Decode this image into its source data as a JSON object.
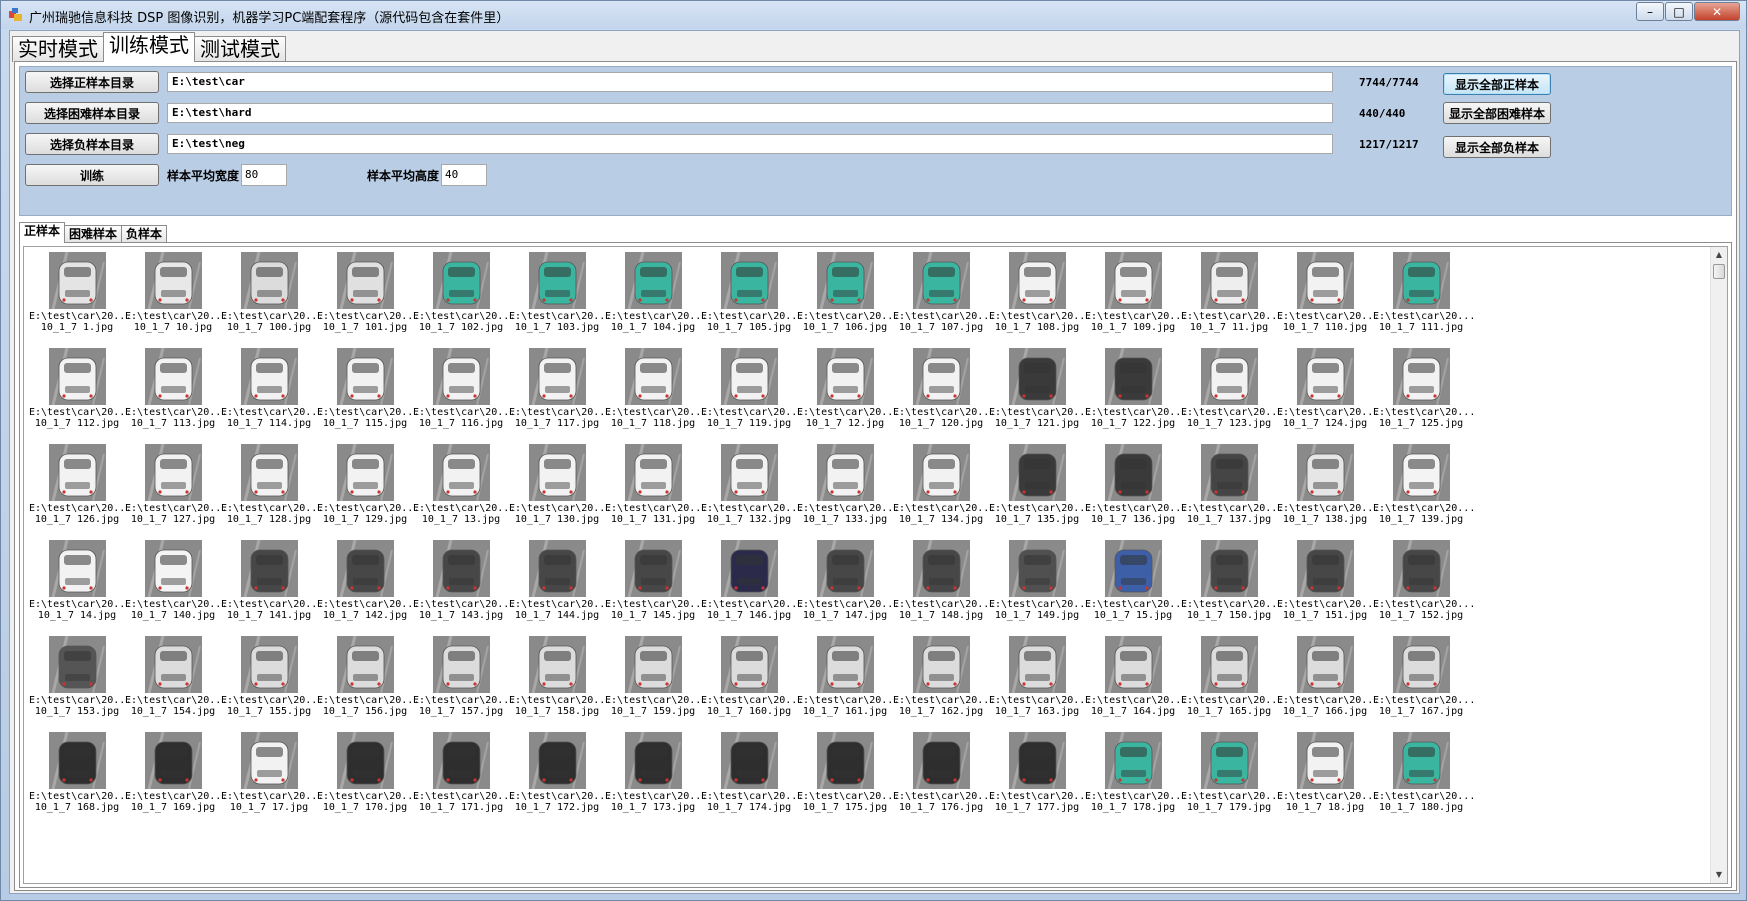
{
  "window": {
    "title": "广州瑞驰信息科技  DSP 图像识别，机器学习PC端配套程序（源代码包含在套件里）",
    "min_label": "–",
    "max_label": "□",
    "close_label": "✕"
  },
  "main_tabs": [
    {
      "label": "实时模式",
      "active": false
    },
    {
      "label": "训练模式",
      "active": true
    },
    {
      "label": "测试模式",
      "active": false
    }
  ],
  "controls": {
    "positive_dir_button": "选择正样本目录",
    "positive_dir_path": "E:\\test\\car",
    "positive_count": "7744/7744",
    "show_all_positive_button": "显示全部正样本",
    "hard_dir_button": "选择困难样本目录",
    "hard_dir_path": "E:\\test\\hard",
    "hard_count": "440/440",
    "show_all_hard_button": "显示全部困难样本",
    "negative_dir_button": "选择负样本目录",
    "negative_dir_path": "E:\\test\\neg",
    "negative_count": "1217/1217",
    "show_all_negative_button": "显示全部负样本",
    "train_button": "训练",
    "avg_width_label": "样本平均宽度",
    "avg_width_value": "80",
    "avg_height_label": "样本平均高度",
    "avg_height_value": "40"
  },
  "sample_tabs": [
    {
      "label": "正样本",
      "active": true
    },
    {
      "label": "困难样本",
      "active": false
    },
    {
      "label": "负样本",
      "active": false
    }
  ],
  "samples": [
    {
      "line1": "E:\\test\\car\\20...",
      "line2": "10_1_7  1.jpg",
      "color": "#e4e4e4"
    },
    {
      "line1": "E:\\test\\car\\20...",
      "line2": "10_1_7  10.jpg",
      "color": "#e8e8e8"
    },
    {
      "line1": "E:\\test\\car\\20...",
      "line2": "10_1_7  100.jpg",
      "color": "#dcdcdc"
    },
    {
      "line1": "E:\\test\\car\\20...",
      "line2": "10_1_7  101.jpg",
      "color": "#e0e0e0"
    },
    {
      "line1": "E:\\test\\car\\20...",
      "line2": "10_1_7  102.jpg",
      "color": "#3ab5a0"
    },
    {
      "line1": "E:\\test\\car\\20...",
      "line2": "10_1_7  103.jpg",
      "color": "#3ab5a0"
    },
    {
      "line1": "E:\\test\\car\\20...",
      "line2": "10_1_7  104.jpg",
      "color": "#3ab5a0"
    },
    {
      "line1": "E:\\test\\car\\20...",
      "line2": "10_1_7  105.jpg",
      "color": "#3ab5a0"
    },
    {
      "line1": "E:\\test\\car\\20...",
      "line2": "10_1_7  106.jpg",
      "color": "#3ab5a0"
    },
    {
      "line1": "E:\\test\\car\\20...",
      "line2": "10_1_7  107.jpg",
      "color": "#3ab5a0"
    },
    {
      "line1": "E:\\test\\car\\20...",
      "line2": "10_1_7  108.jpg",
      "color": "#f2f2f2"
    },
    {
      "line1": "E:\\test\\car\\20...",
      "line2": "10_1_7  109.jpg",
      "color": "#f2f2f2"
    },
    {
      "line1": "E:\\test\\car\\20...",
      "line2": "10_1_7  11.jpg",
      "color": "#eeeeee"
    },
    {
      "line1": "E:\\test\\car\\20...",
      "line2": "10_1_7  110.jpg",
      "color": "#f2f2f2"
    },
    {
      "line1": "E:\\test\\car\\20...",
      "line2": "10_1_7  111.jpg",
      "color": "#3ab5a0"
    },
    {
      "line1": "E:\\test\\car\\20...",
      "line2": "10_1_7  112.jpg",
      "color": "#f2f2f2"
    },
    {
      "line1": "E:\\test\\car\\20...",
      "line2": "10_1_7  113.jpg",
      "color": "#f2f2f2"
    },
    {
      "line1": "E:\\test\\car\\20...",
      "line2": "10_1_7  114.jpg",
      "color": "#f2f2f2"
    },
    {
      "line1": "E:\\test\\car\\20...",
      "line2": "10_1_7  115.jpg",
      "color": "#f2f2f2"
    },
    {
      "line1": "E:\\test\\car\\20...",
      "line2": "10_1_7  116.jpg",
      "color": "#f2f2f2"
    },
    {
      "line1": "E:\\test\\car\\20...",
      "line2": "10_1_7  117.jpg",
      "color": "#f2f2f2"
    },
    {
      "line1": "E:\\test\\car\\20...",
      "line2": "10_1_7  118.jpg",
      "color": "#f2f2f2"
    },
    {
      "line1": "E:\\test\\car\\20...",
      "line2": "10_1_7  119.jpg",
      "color": "#f2f2f2"
    },
    {
      "line1": "E:\\test\\car\\20...",
      "line2": "10_1_7  12.jpg",
      "color": "#f2f2f2"
    },
    {
      "line1": "E:\\test\\car\\20...",
      "line2": "10_1_7  120.jpg",
      "color": "#f2f2f2"
    },
    {
      "line1": "E:\\test\\car\\20...",
      "line2": "10_1_7  121.jpg",
      "color": "#3a3a3a"
    },
    {
      "line1": "E:\\test\\car\\20...",
      "line2": "10_1_7  122.jpg",
      "color": "#3a3a3a"
    },
    {
      "line1": "E:\\test\\car\\20...",
      "line2": "10_1_7  123.jpg",
      "color": "#f2f2f2"
    },
    {
      "line1": "E:\\test\\car\\20...",
      "line2": "10_1_7  124.jpg",
      "color": "#f2f2f2"
    },
    {
      "line1": "E:\\test\\car\\20...",
      "line2": "10_1_7  125.jpg",
      "color": "#f2f2f2"
    },
    {
      "line1": "E:\\test\\car\\20...",
      "line2": "10_1_7  126.jpg",
      "color": "#f2f2f2"
    },
    {
      "line1": "E:\\test\\car\\20...",
      "line2": "10_1_7  127.jpg",
      "color": "#f2f2f2"
    },
    {
      "line1": "E:\\test\\car\\20...",
      "line2": "10_1_7  128.jpg",
      "color": "#f2f2f2"
    },
    {
      "line1": "E:\\test\\car\\20...",
      "line2": "10_1_7  129.jpg",
      "color": "#f2f2f2"
    },
    {
      "line1": "E:\\test\\car\\20...",
      "line2": "10_1_7  13.jpg",
      "color": "#f2f2f2"
    },
    {
      "line1": "E:\\test\\car\\20...",
      "line2": "10_1_7  130.jpg",
      "color": "#f2f2f2"
    },
    {
      "line1": "E:\\test\\car\\20...",
      "line2": "10_1_7  131.jpg",
      "color": "#f2f2f2"
    },
    {
      "line1": "E:\\test\\car\\20...",
      "line2": "10_1_7  132.jpg",
      "color": "#f2f2f2"
    },
    {
      "line1": "E:\\test\\car\\20...",
      "line2": "10_1_7  133.jpg",
      "color": "#f2f2f2"
    },
    {
      "line1": "E:\\test\\car\\20...",
      "line2": "10_1_7  134.jpg",
      "color": "#f2f2f2"
    },
    {
      "line1": "E:\\test\\car\\20...",
      "line2": "10_1_7  135.jpg",
      "color": "#3a3a3a"
    },
    {
      "line1": "E:\\test\\car\\20...",
      "line2": "10_1_7  136.jpg",
      "color": "#3a3a3a"
    },
    {
      "line1": "E:\\test\\car\\20...",
      "line2": "10_1_7  137.jpg",
      "color": "#454545"
    },
    {
      "line1": "E:\\test\\car\\20...",
      "line2": "10_1_7  138.jpg",
      "color": "#e6e6e6"
    },
    {
      "line1": "E:\\test\\car\\20...",
      "line2": "10_1_7  139.jpg",
      "color": "#f4f4f4"
    },
    {
      "line1": "E:\\test\\car\\20...",
      "line2": "10_1_7  14.jpg",
      "color": "#f2f2f2"
    },
    {
      "line1": "E:\\test\\car\\20...",
      "line2": "10_1_7  140.jpg",
      "color": "#f4f4f4"
    },
    {
      "line1": "E:\\test\\car\\20...",
      "line2": "10_1_7  141.jpg",
      "color": "#474747"
    },
    {
      "line1": "E:\\test\\car\\20...",
      "line2": "10_1_7  142.jpg",
      "color": "#474747"
    },
    {
      "line1": "E:\\test\\car\\20...",
      "line2": "10_1_7  143.jpg",
      "color": "#474747"
    },
    {
      "line1": "E:\\test\\car\\20...",
      "line2": "10_1_7  144.jpg",
      "color": "#474747"
    },
    {
      "line1": "E:\\test\\car\\20...",
      "line2": "10_1_7  145.jpg",
      "color": "#474747"
    },
    {
      "line1": "E:\\test\\car\\20...",
      "line2": "10_1_7  146.jpg",
      "color": "#2b2a4a"
    },
    {
      "line1": "E:\\test\\car\\20...",
      "line2": "10_1_7  147.jpg",
      "color": "#474747"
    },
    {
      "line1": "E:\\test\\car\\20...",
      "line2": "10_1_7  148.jpg",
      "color": "#474747"
    },
    {
      "line1": "E:\\test\\car\\20...",
      "line2": "10_1_7  149.jpg",
      "color": "#505050"
    },
    {
      "line1": "E:\\test\\car\\20...",
      "line2": "10_1_7  15.jpg",
      "color": "#3d5fa8"
    },
    {
      "line1": "E:\\test\\car\\20...",
      "line2": "10_1_7  150.jpg",
      "color": "#474747"
    },
    {
      "line1": "E:\\test\\car\\20...",
      "line2": "10_1_7  151.jpg",
      "color": "#474747"
    },
    {
      "line1": "E:\\test\\car\\20...",
      "line2": "10_1_7  152.jpg",
      "color": "#474747"
    },
    {
      "line1": "E:\\test\\car\\20...",
      "line2": "10_1_7  153.jpg",
      "color": "#555555"
    },
    {
      "line1": "E:\\test\\car\\20...",
      "line2": "10_1_7  154.jpg",
      "color": "#dcdcdc"
    },
    {
      "line1": "E:\\test\\car\\20...",
      "line2": "10_1_7  155.jpg",
      "color": "#dcdcdc"
    },
    {
      "line1": "E:\\test\\car\\20...",
      "line2": "10_1_7  156.jpg",
      "color": "#dcdcdc"
    },
    {
      "line1": "E:\\test\\car\\20...",
      "line2": "10_1_7  157.jpg",
      "color": "#dcdcdc"
    },
    {
      "line1": "E:\\test\\car\\20...",
      "line2": "10_1_7  158.jpg",
      "color": "#dcdcdc"
    },
    {
      "line1": "E:\\test\\car\\20...",
      "line2": "10_1_7  159.jpg",
      "color": "#dcdcdc"
    },
    {
      "line1": "E:\\test\\car\\20...",
      "line2": "10_1_7  160.jpg",
      "color": "#dcdcdc"
    },
    {
      "line1": "E:\\test\\car\\20...",
      "line2": "10_1_7  161.jpg",
      "color": "#dcdcdc"
    },
    {
      "line1": "E:\\test\\car\\20...",
      "line2": "10_1_7  162.jpg",
      "color": "#dcdcdc"
    },
    {
      "line1": "E:\\test\\car\\20...",
      "line2": "10_1_7  163.jpg",
      "color": "#dcdcdc"
    },
    {
      "line1": "E:\\test\\car\\20...",
      "line2": "10_1_7  164.jpg",
      "color": "#dcdcdc"
    },
    {
      "line1": "E:\\test\\car\\20...",
      "line2": "10_1_7  165.jpg",
      "color": "#dcdcdc"
    },
    {
      "line1": "E:\\test\\car\\20...",
      "line2": "10_1_7  166.jpg",
      "color": "#dcdcdc"
    },
    {
      "line1": "E:\\test\\car\\20...",
      "line2": "10_1_7  167.jpg",
      "color": "#dcdcdc"
    },
    {
      "line1": "E:\\test\\car\\20...",
      "line2": "10_1_7  168.jpg",
      "color": "#2e2e2e"
    },
    {
      "line1": "E:\\test\\car\\20...",
      "line2": "10_1_7  169.jpg",
      "color": "#2e2e2e"
    },
    {
      "line1": "E:\\test\\car\\20...",
      "line2": "10_1_7  17.jpg",
      "color": "#f2f2f2"
    },
    {
      "line1": "E:\\test\\car\\20...",
      "line2": "10_1_7  170.jpg",
      "color": "#2e2e2e"
    },
    {
      "line1": "E:\\test\\car\\20...",
      "line2": "10_1_7  171.jpg",
      "color": "#2e2e2e"
    },
    {
      "line1": "E:\\test\\car\\20...",
      "line2": "10_1_7  172.jpg",
      "color": "#2e2e2e"
    },
    {
      "line1": "E:\\test\\car\\20...",
      "line2": "10_1_7  173.jpg",
      "color": "#2e2e2e"
    },
    {
      "line1": "E:\\test\\car\\20...",
      "line2": "10_1_7  174.jpg",
      "color": "#2e2e2e"
    },
    {
      "line1": "E:\\test\\car\\20...",
      "line2": "10_1_7  175.jpg",
      "color": "#2e2e2e"
    },
    {
      "line1": "E:\\test\\car\\20...",
      "line2": "10_1_7  176.jpg",
      "color": "#2e2e2e"
    },
    {
      "line1": "E:\\test\\car\\20...",
      "line2": "10_1_7  177.jpg",
      "color": "#2e2e2e"
    },
    {
      "line1": "E:\\test\\car\\20...",
      "line2": "10_1_7  178.jpg",
      "color": "#3ab5a0"
    },
    {
      "line1": "E:\\test\\car\\20...",
      "line2": "10_1_7  179.jpg",
      "color": "#3ab5a0"
    },
    {
      "line1": "E:\\test\\car\\20...",
      "line2": "10_1_7  18.jpg",
      "color": "#f2f2f2"
    },
    {
      "line1": "E:\\test\\car\\20...",
      "line2": "10_1_7  180.jpg",
      "color": "#3ab5a0"
    }
  ]
}
